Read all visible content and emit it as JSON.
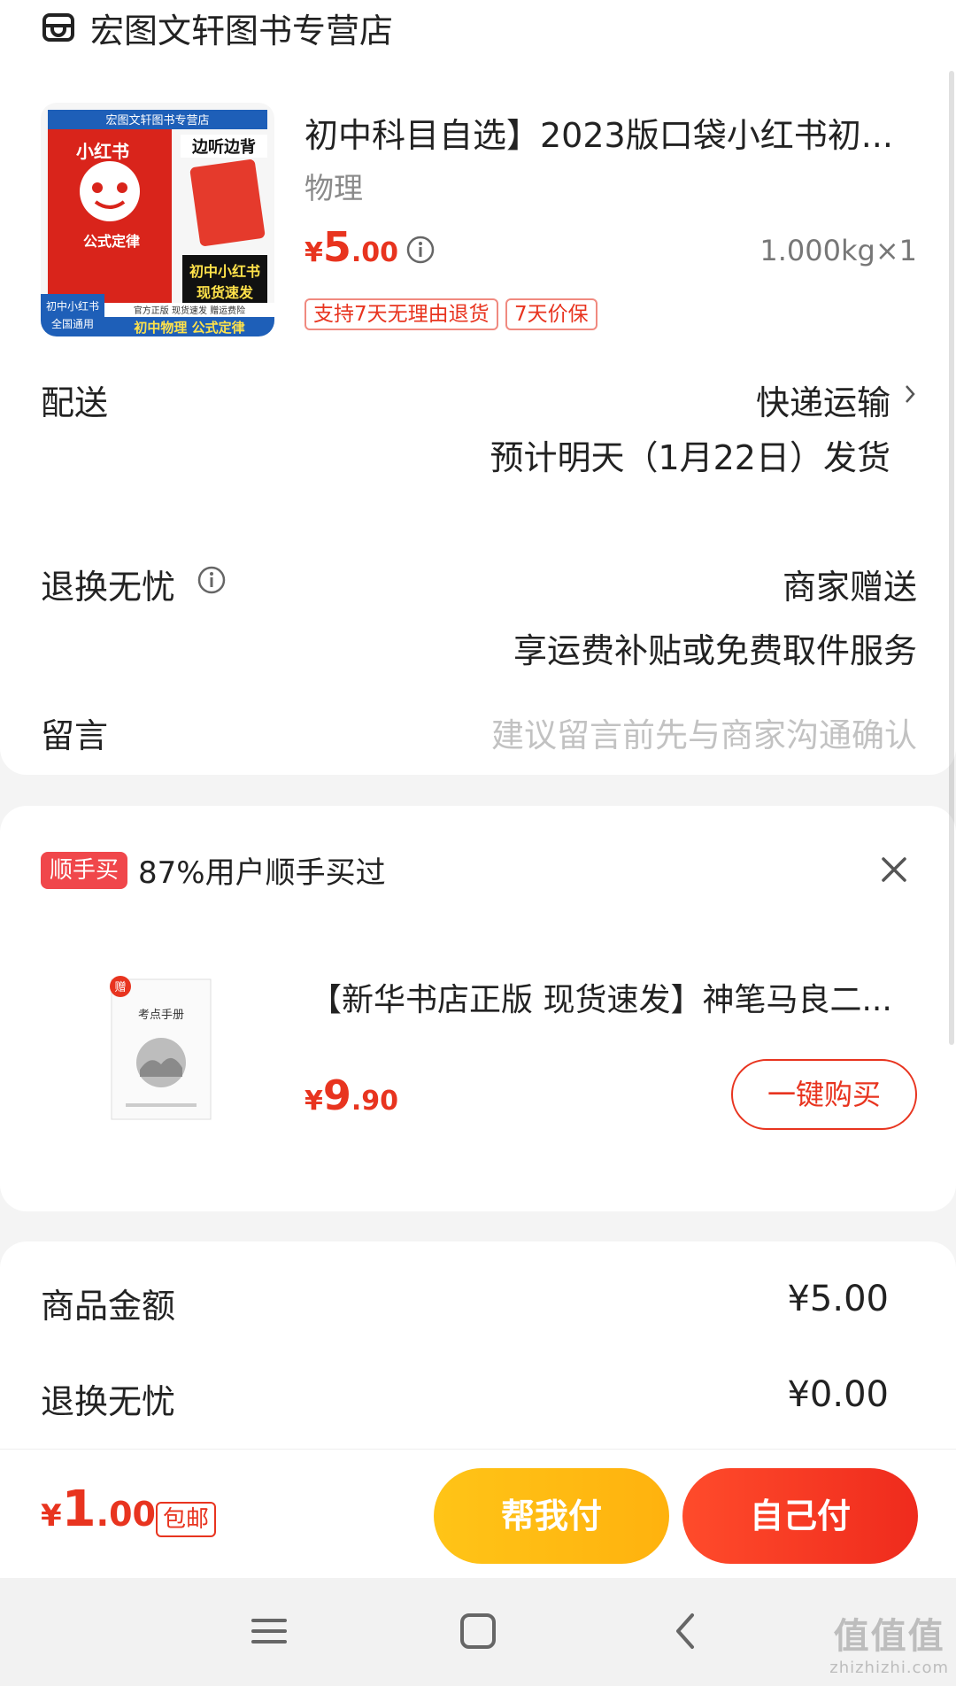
{
  "store": {
    "name": "宏图文轩图书专营店",
    "icon": "shop-icon"
  },
  "product": {
    "title": "初中科目自选】2023版口袋小红书初...",
    "spec": "物理",
    "price": {
      "currency": "¥",
      "int": "5",
      "dec": ".00"
    },
    "weight": "1.000kg×1",
    "tags": [
      "支持7天无理由退货",
      "7天价保"
    ],
    "image_text": {
      "top_banner": "宏图文轩图书专营店",
      "brand": "小红书",
      "cover_title": "公式定律",
      "listen": "边听边背",
      "promo": [
        "初中小红书",
        "现货速发"
      ],
      "bottom_left": [
        "初中小红书",
        "全国通用"
      ],
      "bottom_strip": "官方正版 现货速发 赠运费险",
      "bottom_title": "初中物理 公式定律"
    }
  },
  "delivery": {
    "label": "配送",
    "method": "快递运输",
    "estimate": "预计明天（1月22日）发货"
  },
  "return_service": {
    "label": "退换无忧",
    "value": "商家赠送",
    "desc": "享运费补贴或免费取件服务"
  },
  "message": {
    "label": "留言",
    "placeholder": "建议留言前先与商家沟通确认"
  },
  "recommend": {
    "badge": "顺手买",
    "title": "87%用户顺手买过",
    "item_name": "【新华书店正版 现货速发】神笔马良二...",
    "price": {
      "currency": "¥",
      "int": "9",
      "dec": ".90"
    },
    "buy_label": "一键购买",
    "image_text": {
      "gift": "赠",
      "book_title": "考点手册"
    }
  },
  "summary": {
    "rows": [
      {
        "label": "商品金额",
        "value": "¥5.00"
      },
      {
        "label": "退换无忧",
        "value": "¥0.00"
      }
    ]
  },
  "bottom": {
    "total": {
      "currency": "¥",
      "int": "1",
      "dec": ".00"
    },
    "free_shipping": "包邮",
    "help_pay": "帮我付",
    "self_pay": "自己付"
  },
  "watermark": {
    "main": "值值值",
    "sub": "zhizhizhi.com"
  },
  "colors": {
    "accent": "#e8341f",
    "yellow": "#ffb20e",
    "badge_red": "#f0474b"
  }
}
